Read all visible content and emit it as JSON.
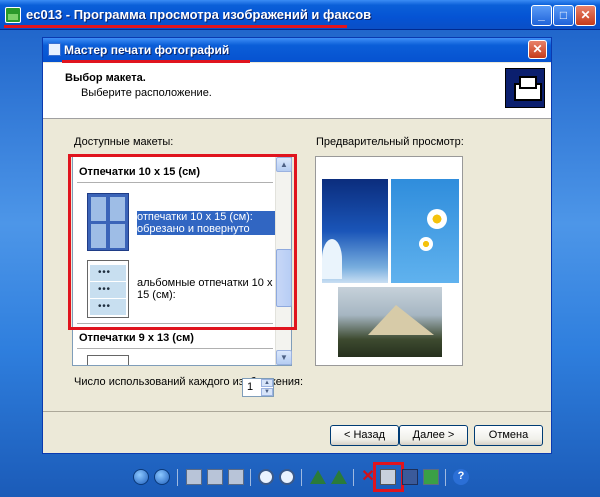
{
  "window": {
    "title": "ec013 - Программа просмотра изображений и факсов",
    "buttons": {
      "minimize": "_",
      "maximize": "□",
      "close": "✕"
    }
  },
  "dialog": {
    "title": "Мастер печати фотографий",
    "close": "✕",
    "header_title": "Выбор макета.",
    "header_subtitle": "Выберите расположение.",
    "available_label": "Доступные макеты:",
    "preview_label": "Предварительный просмотр:",
    "layouts": {
      "category1": "Отпечатки 10 x 15 (см)",
      "item1": "отпечатки 10 x 15 (см): обрезано и повернуто",
      "item2": "альбомные отпечатки 10 x 15 (см):",
      "category2": "Отпечатки 9 x 13 (см)",
      "selected": "item1"
    },
    "uses_label": "Число использований каждого изображения:",
    "uses_value": "1",
    "buttons": {
      "back": "< Назад",
      "next": "Далее >",
      "cancel": "Отмена"
    }
  },
  "toolbar": {
    "icons": [
      "previous-icon",
      "next-icon",
      "best-fit-icon",
      "actual-size-icon",
      "slideshow-icon",
      "zoom-in-icon",
      "zoom-out-icon",
      "rotate-clockwise-icon",
      "rotate-counterclockwise-icon",
      "delete-icon",
      "print-icon",
      "save-icon",
      "open-editor-icon",
      "help-icon"
    ],
    "help_glyph": "?",
    "delete_glyph": "✕"
  },
  "highlight_color": "#e0141e"
}
